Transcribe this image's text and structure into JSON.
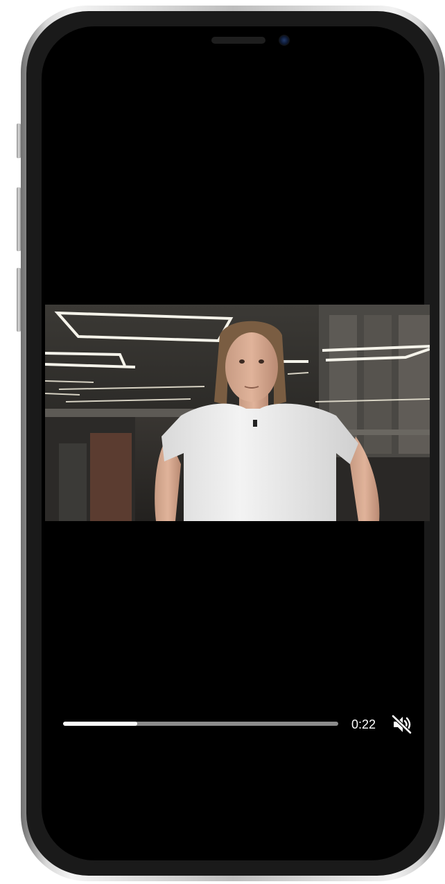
{
  "player": {
    "progress_fraction": 0.27,
    "time_elapsed": "0:22",
    "mute_icon": "speaker-muted-icon",
    "muted": true
  },
  "colors": {
    "screen_background": "#000000",
    "progress_fill": "#ffffff",
    "progress_track": "#8c8c8c",
    "time_text": "#ffffff"
  },
  "video": {
    "content": "video-frame"
  }
}
